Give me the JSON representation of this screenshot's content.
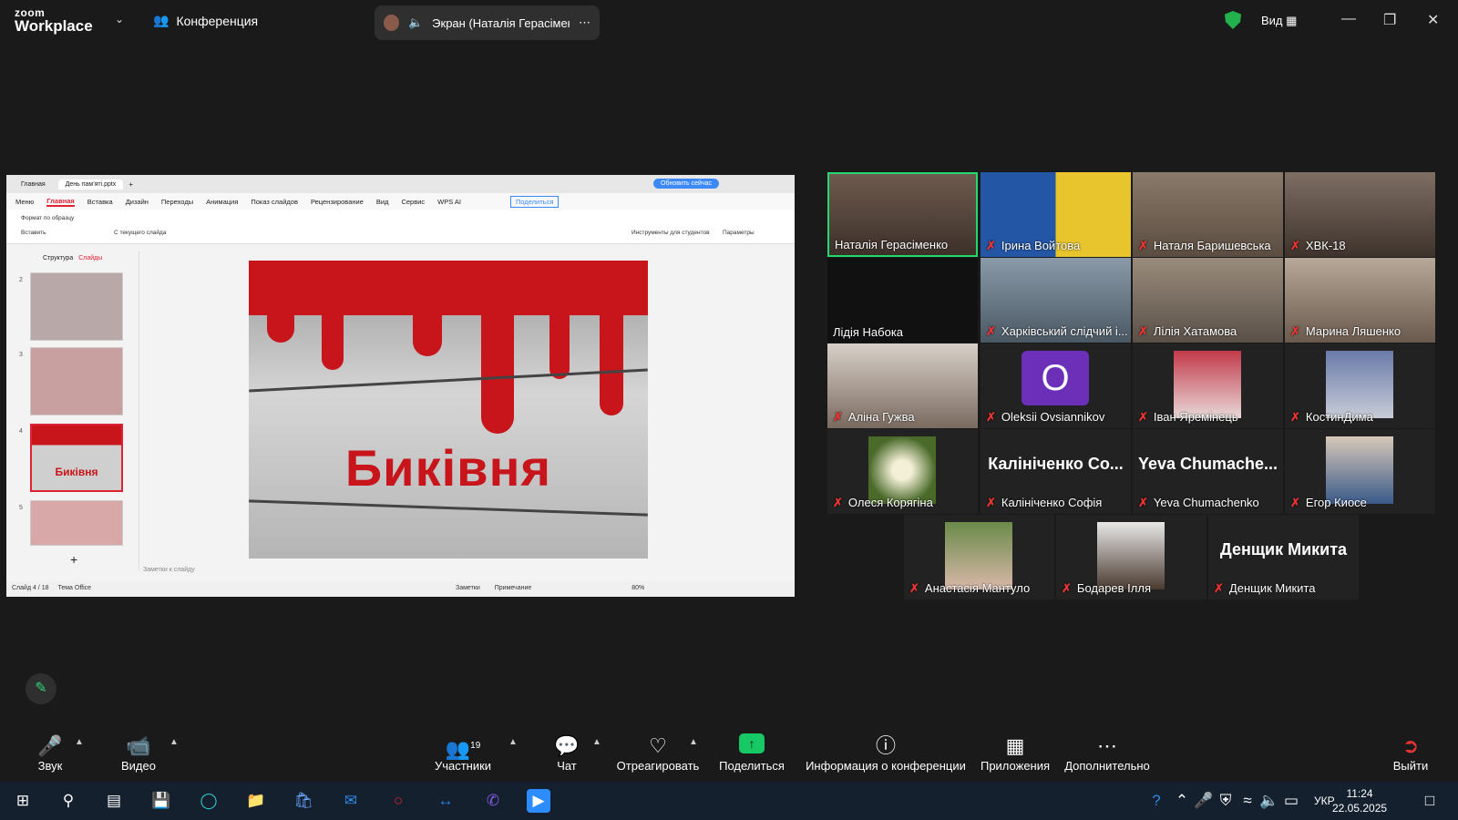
{
  "app": {
    "logo_line1": "zoom",
    "logo_line2": "Workplace",
    "meeting_label": "Конференция",
    "view_label": "Вид"
  },
  "share_pill": {
    "text": "Экран (Наталія Герасіменк"
  },
  "wps": {
    "tabs": [
      "Главная",
      "День пам'яті.pptx"
    ],
    "update_button": "Обновить сейчас",
    "share_button": "Поделиться",
    "menu": [
      "Меню",
      "Главная",
      "Вставка",
      "Дизайн",
      "Переходы",
      "Анимация",
      "Показ слайдов",
      "Рецензирование",
      "Вид",
      "Сервис",
      "WPS AI"
    ],
    "ribbon": {
      "format": "Формат по образцу",
      "paste": "Вставить",
      "from_current": "С текущего слайда",
      "student_tools": "Инструменты для студентов",
      "params": "Параметры"
    },
    "panel": {
      "structure": "Структура",
      "slides": "Слайды"
    },
    "thumb_numbers": [
      "2",
      "3",
      "4",
      "5"
    ],
    "thumb_title": "Биківня",
    "slide_title": "Биківня",
    "notes": "Заметки к слайду",
    "status": {
      "slide": "Слайд 4 / 18",
      "theme": "Тема Office",
      "notes": "Заметки",
      "comment": "Примечание",
      "zoom": "80%"
    }
  },
  "participants": [
    {
      "name": "Наталія Герасіменко",
      "muted": false
    },
    {
      "name": "Ірина Войтова",
      "muted": true
    },
    {
      "name": "Наталя Баришевська",
      "muted": true
    },
    {
      "name": "ХВК-18",
      "muted": true
    },
    {
      "name": "Лідія Набока",
      "muted": false
    },
    {
      "name": "Харківський слідчий і...",
      "muted": true
    },
    {
      "name": "Лілія Хатамова",
      "muted": true
    },
    {
      "name": "Марина Ляшенко",
      "muted": true
    },
    {
      "name": "Аліна Гужва",
      "muted": true
    },
    {
      "name": "Oleksii Ovsiannikov",
      "muted": true,
      "avatar_letter": "O"
    },
    {
      "name": "Іван Яремінець",
      "muted": true
    },
    {
      "name": "КостинДима",
      "muted": true
    },
    {
      "name": "Олеся Корягіна",
      "muted": true
    },
    {
      "name": "Калініченко Софія",
      "muted": true,
      "big_label": "Калініченко Со..."
    },
    {
      "name": "Yeva Chumachenko",
      "muted": true,
      "big_label": "Yeva  Chumache..."
    },
    {
      "name": "Егор Киосе",
      "muted": true
    },
    {
      "name": "Анастасія Мантуло",
      "muted": true
    },
    {
      "name": "Бодарев Ілля",
      "muted": true
    },
    {
      "name": "Денщик Микита",
      "muted": true,
      "big_label": "Денщик Микита"
    }
  ],
  "toolbar": {
    "audio": "Звук",
    "video": "Видео",
    "participants": "Участники",
    "participants_count": "19",
    "chat": "Чат",
    "react": "Отреагировать",
    "share": "Поделиться",
    "info": "Информация о конференции",
    "apps": "Приложения",
    "more": "Дополнительно",
    "leave": "Выйти"
  },
  "taskbar": {
    "lang": "УКР",
    "time": "11:24",
    "date": "22.05.2025"
  },
  "colors": {
    "active_speaker": "#23d96c",
    "share_green": "#17c964",
    "slide_red": "#c8141b"
  }
}
